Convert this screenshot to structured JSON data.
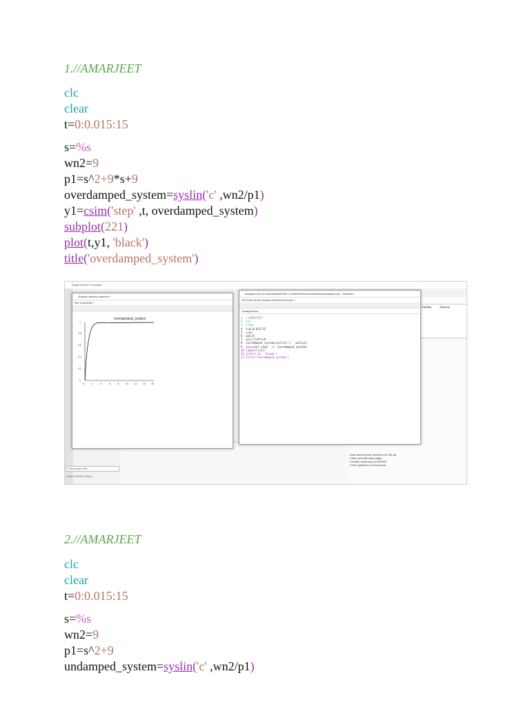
{
  "section1": {
    "heading": "1.//AMARJEET",
    "lines": {
      "clc": "clc",
      "clear": "clear",
      "t_var": "t=",
      "t_range": "0:0.015:15",
      "s_var": "s=",
      "s_val": "%s",
      "wn2_var": "wn2=",
      "wn2_val": "9",
      "p1_a": "p1=s^",
      "p1_b": "2",
      "p1_c": "+",
      "p1_d": "9",
      "p1_e": "*s+",
      "p1_f": "9",
      "sys_var": "overdamped_system=",
      "syslin_fn": "syslin",
      "sys_open": "(",
      "sys_str": "'c'",
      "sys_rest": " ,wn2/p1",
      "sys_close": ")",
      "y1_var": "y1=",
      "csim_fn": "csim",
      "y1_open": "(",
      "y1_str": "'step'",
      "y1_rest": " ,t, overdamped_system",
      "y1_close": ")",
      "subplot_fn": "subplot",
      "subplot_open": "(",
      "subplot_arg": "221",
      "subplot_close": ")",
      "plot_fn": "plot",
      "plot_open": "(",
      "plot_args": "t,y1, ",
      "plot_str": "'black'",
      "plot_close": ")",
      "title_fn": "title",
      "title_open": "(",
      "title_str": "'overdamped_system'",
      "title_close": ")"
    }
  },
  "screenshot": {
    "console_title": "Scilab 2024.0.0 Console",
    "graphic_title": "Graphic window number 0",
    "graphic_menu": "File   Tools   Edit   ?",
    "plot_title": "overdamped_system",
    "plot_x_ticks": [
      "0",
      "2",
      "4",
      "6",
      "8",
      "10",
      "12",
      "14",
      "16"
    ],
    "plot_y_ticks": [
      "0",
      "0.2",
      "0.4",
      "0.6",
      "0.8",
      "1"
    ],
    "editor_title": "amarjeet.sce (C:\\Users\\AMARJEET KUMAR\\OneDrive\\Desktop\\amarjeet.sce) - SciNotes",
    "editor_menu": "File   Edit   Format   Options   Window   Execute   ?",
    "editor_tab": "*amarjeet.sce",
    "editor_code": [
      "1  //AMARJEET",
      "2  clc",
      "3  clear",
      "4  t=0:0.015:15",
      "5  s=%s",
      "6  wn2=9",
      "7  p1=s^2+9*s+9",
      "8  overdamped_system=syslin('c' ,wn2/p1)",
      "9  y1=csim('step' ,t, overdamped_system)",
      "10 subplot(221)",
      "11 plot(t,y1, 'black')",
      "12 title('overdamped_system')"
    ],
    "var_header": [
      "Visibility",
      "Memory"
    ],
    "help_lines": [
      "• Add and improve functions on GitLab.",
      "• View and edit help pages.",
      "• Publish toolboxes on ATOMS.",
      "• Post questions on Discourse."
    ],
    "search_placeholder": "Filebrowser filter",
    "case_label": "Case sensitive",
    "regex_label": "Rege..."
  },
  "section2": {
    "heading": "2.//AMARJEET",
    "lines": {
      "clc": "clc",
      "clear": "clear",
      "t_var": "t=",
      "t_range": "0:0.015:15",
      "s_var": "s=",
      "s_val": "%s",
      "wn2_var": "wn2=",
      "wn2_val": "9",
      "p1_a": "p1=s^",
      "p1_b": "2",
      "p1_c": "+",
      "p1_d": "9",
      "sys_var": "undamped_system=",
      "syslin_fn": "syslin",
      "sys_open": "(",
      "sys_str": "'c'",
      "sys_rest": " ,wn2/p1",
      "sys_close": ")"
    }
  }
}
